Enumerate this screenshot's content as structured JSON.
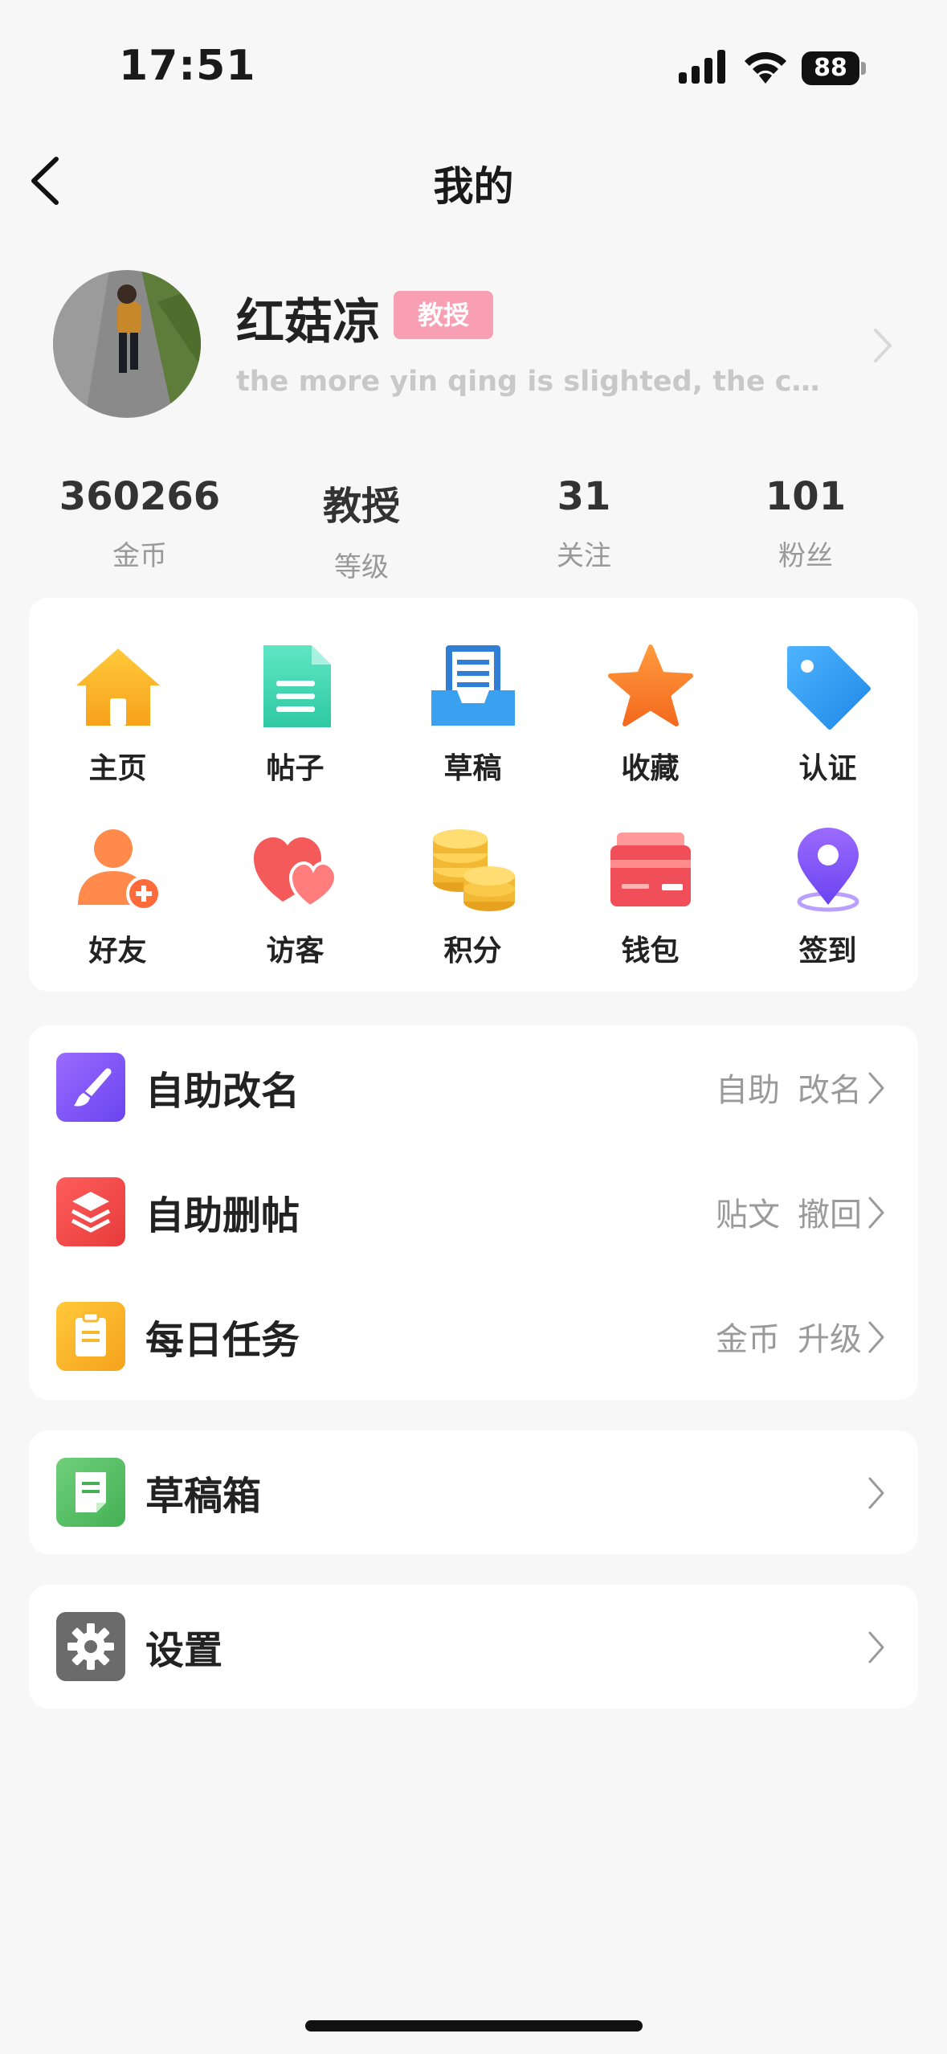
{
  "status": {
    "time": "17:51",
    "battery": "88"
  },
  "nav": {
    "title": "我的"
  },
  "profile": {
    "name": "红菇凉",
    "level_badge": "教授",
    "bio": "the more yin qing is slighted, the colde..."
  },
  "stats": [
    {
      "value": "360266",
      "label": "金币"
    },
    {
      "value": "教授",
      "label": "等级"
    },
    {
      "value": "31",
      "label": "关注"
    },
    {
      "value": "101",
      "label": "粉丝"
    }
  ],
  "grid": [
    {
      "label": "主页",
      "icon": "home-icon"
    },
    {
      "label": "帖子",
      "icon": "document-icon"
    },
    {
      "label": "草稿",
      "icon": "draft-tray-icon"
    },
    {
      "label": "收藏",
      "icon": "star-icon"
    },
    {
      "label": "认证",
      "icon": "tag-icon"
    },
    {
      "label": "好友",
      "icon": "add-friend-icon"
    },
    {
      "label": "访客",
      "icon": "hearts-icon"
    },
    {
      "label": "积分",
      "icon": "coins-icon"
    },
    {
      "label": "钱包",
      "icon": "wallet-card-icon"
    },
    {
      "label": "签到",
      "icon": "location-pin-icon"
    }
  ],
  "menu": [
    {
      "label": "自助改名",
      "right": [
        "自助",
        "改名"
      ],
      "icon": "brush-icon",
      "color": "#8b5cf6"
    },
    {
      "label": "自助删帖",
      "right": [
        "贴文",
        "撤回"
      ],
      "icon": "layers-icon",
      "color": "#ef4444"
    },
    {
      "label": "每日任务",
      "right": [
        "金币",
        "升级"
      ],
      "icon": "clipboard-icon",
      "color": "#f5b82e"
    }
  ],
  "drafts": {
    "label": "草稿箱",
    "icon": "note-icon",
    "color": "#5cbf6a"
  },
  "settings": {
    "label": "设置",
    "icon": "gear-icon",
    "color": "#6b6b6b"
  }
}
